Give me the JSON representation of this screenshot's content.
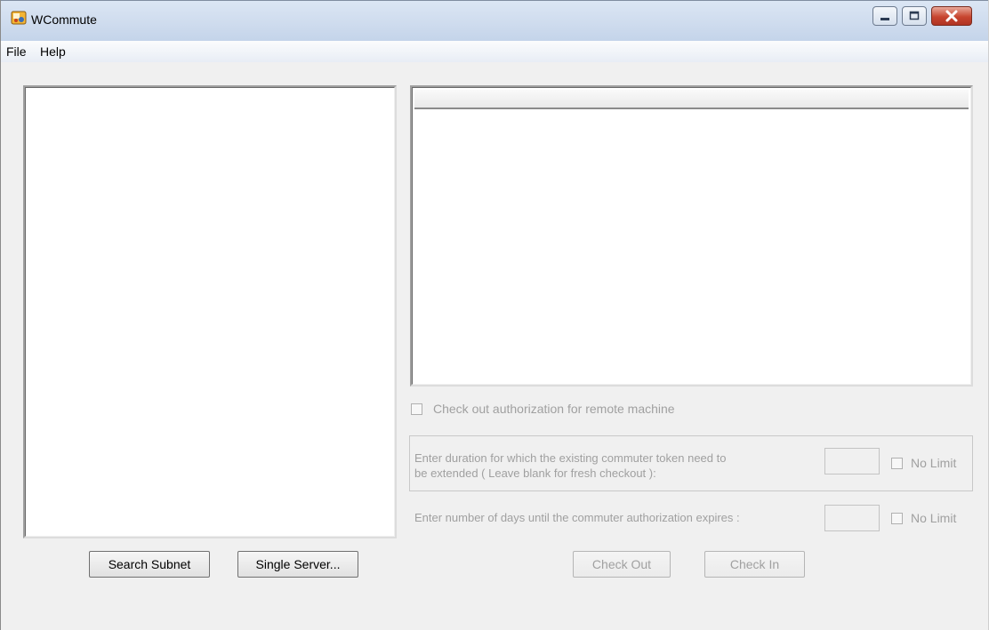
{
  "window": {
    "title": "WCommute"
  },
  "menu": {
    "file": "File",
    "help": "Help"
  },
  "buttons": {
    "search_subnet": "Search Subnet",
    "single_server": "Single Server...",
    "check_out": "Check Out",
    "check_in": "Check In"
  },
  "options": {
    "remote_checkout_label": "Check out authorization for remote machine",
    "duration_label_line1": "Enter duration for which the existing commuter token need to",
    "duration_label_line2": "be extended ( Leave blank for fresh checkout ):",
    "duration_value": "",
    "days_label": "Enter number of days until the commuter authorization expires :",
    "days_value": "",
    "no_limit_label": "No Limit"
  }
}
